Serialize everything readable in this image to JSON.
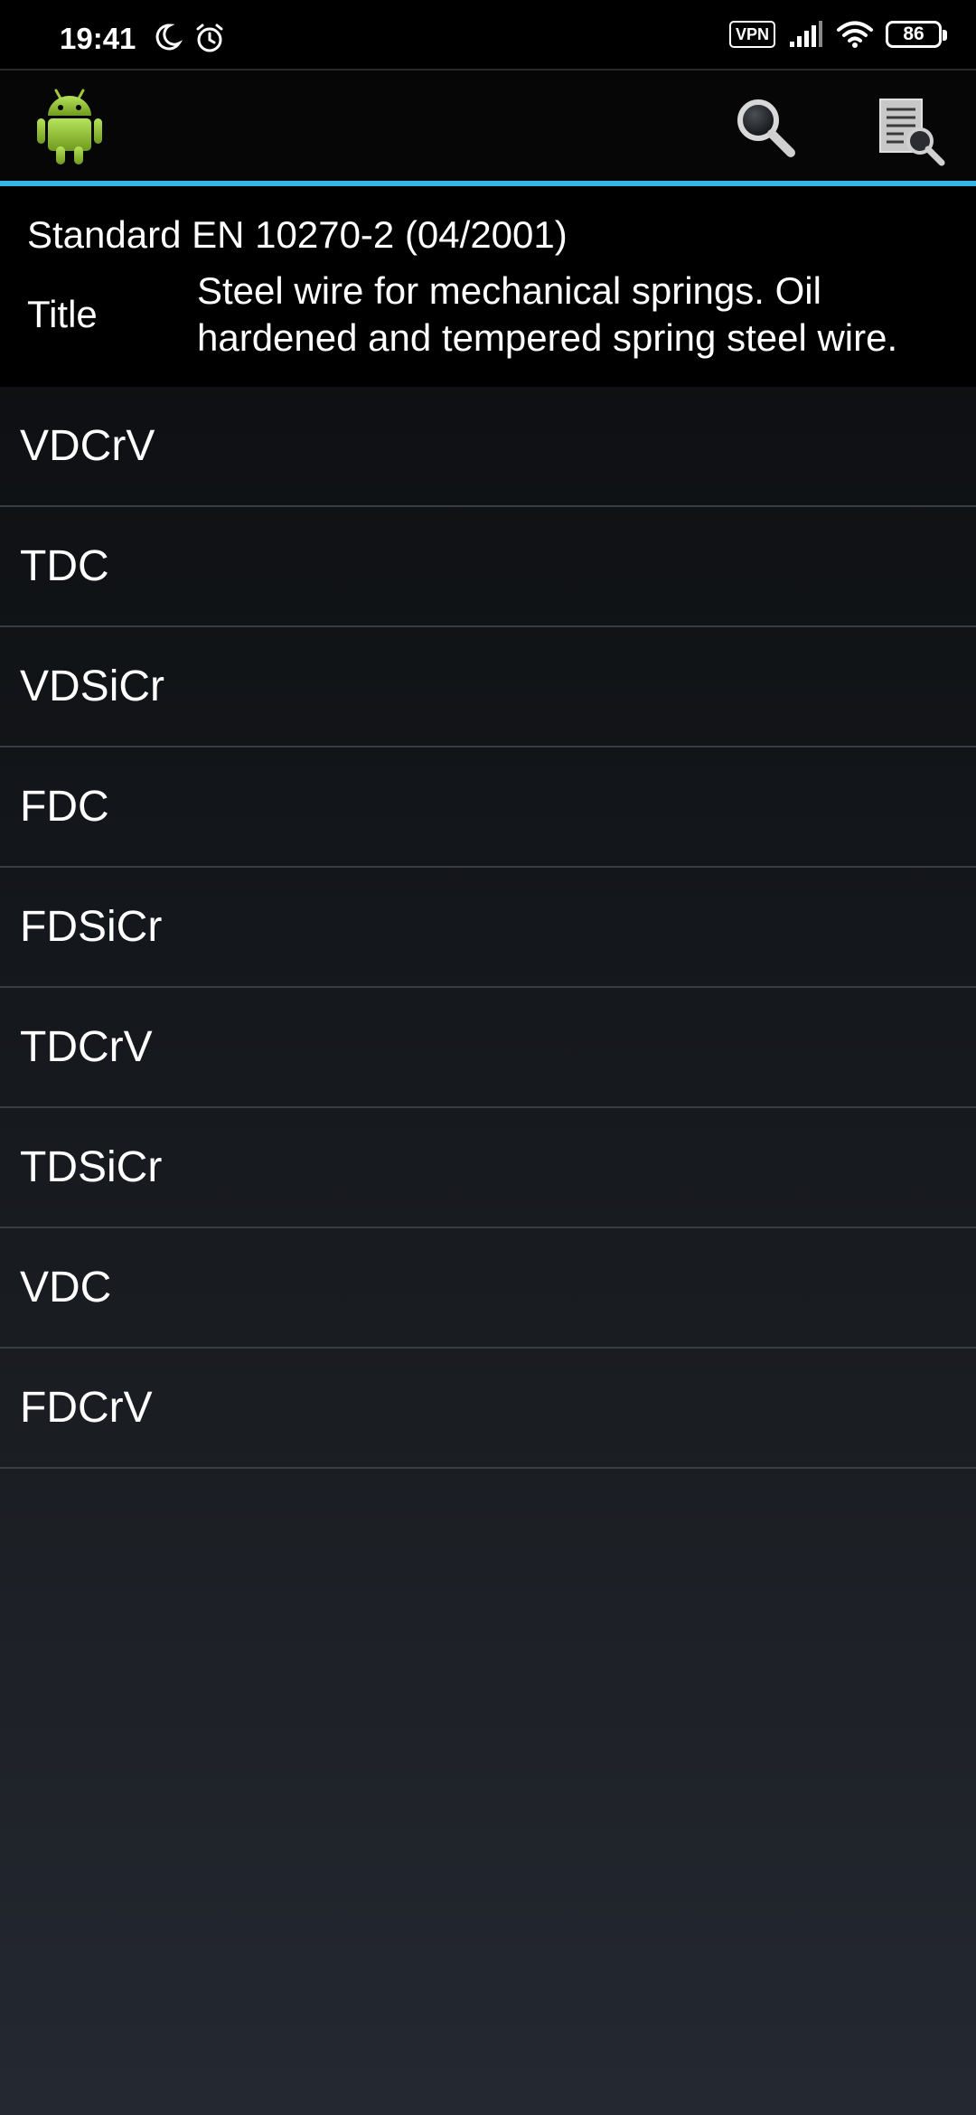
{
  "status_bar": {
    "time": "19:41",
    "vpn_label": "VPN",
    "battery_level": "86",
    "icons": [
      "moon-icon",
      "alarm-icon",
      "signal-icon",
      "wifi-icon",
      "battery-icon"
    ]
  },
  "action_bar": {
    "icons": [
      "android-app-icon",
      "search-icon",
      "document-search-icon"
    ],
    "accent_color": "#33b5e5"
  },
  "header": {
    "standard": "Standard EN 10270-2 (04/2001)",
    "title_label": "Title",
    "title_value": "Steel wire for mechanical springs. Oil hardened and tempered spring steel wire."
  },
  "grades": [
    "VDCrV",
    "TDC",
    "VDSiCr",
    "FDC",
    "FDSiCr",
    "TDCrV",
    "TDSiCr",
    "VDC",
    "FDCrV"
  ]
}
